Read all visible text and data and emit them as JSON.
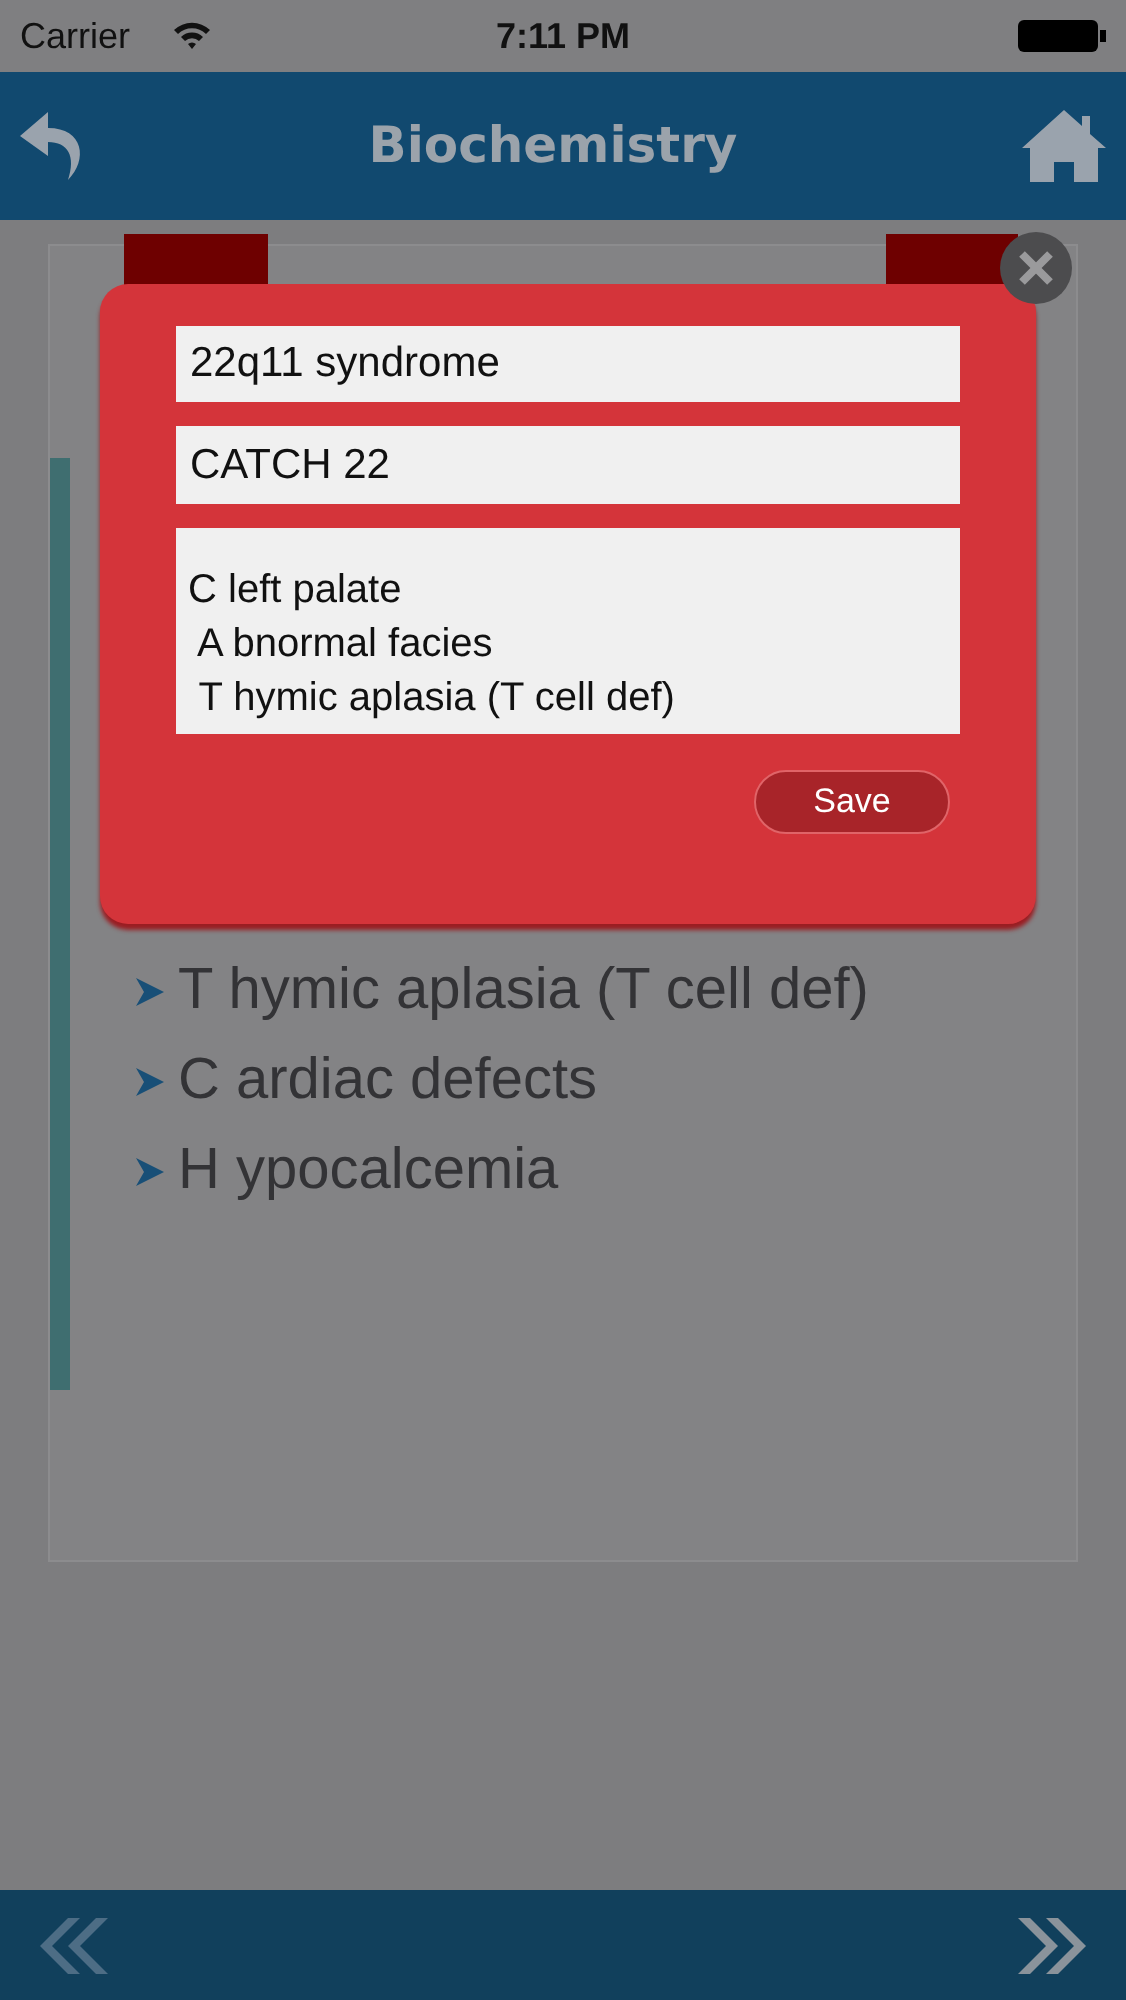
{
  "status_bar": {
    "carrier": "Carrier",
    "time": "7:11 PM"
  },
  "nav_bar": {
    "title": "Biochemistry"
  },
  "list": [
    {
      "text": "T hymic aplasia (T cell def)"
    },
    {
      "text": "C ardiac defects"
    },
    {
      "text": "H ypocalcemia"
    }
  ],
  "dialog": {
    "title_value": "22q11 syndrome",
    "mnemonic_value": "CATCH 22",
    "notes_value": "C left palate\n A bnormal facies\n T hymic aplasia (T cell def)",
    "save_label": "Save"
  }
}
